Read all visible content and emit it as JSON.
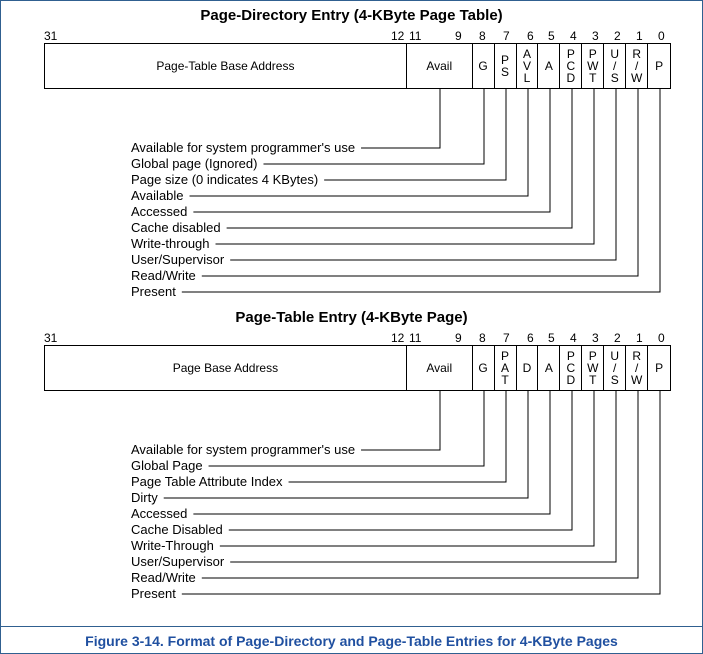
{
  "pde": {
    "title": "Page-Directory Entry (4-KByte Page Table)",
    "bit_left": "31",
    "bit_base_lo": "12",
    "bit_avail_hi": "11",
    "bits": [
      "9",
      "8",
      "7",
      "6",
      "5",
      "4",
      "3",
      "2",
      "1",
      "0"
    ],
    "base": "Page-Table Base Address",
    "avail": "Avail",
    "fields": [
      "G",
      "P\nS",
      "A\nV\nL",
      "A",
      "P\nC\nD",
      "P\nW\nT",
      "U\n/\nS",
      "R\n/\nW",
      "P"
    ],
    "descs": [
      "Available for system programmer's use",
      "Global page (Ignored)",
      "Page size (0 indicates 4 KBytes)",
      "Available",
      "Accessed",
      "Cache disabled",
      "Write-through",
      "User/Supervisor",
      "Read/Write",
      "Present"
    ]
  },
  "pte": {
    "title": "Page-Table Entry (4-KByte Page)",
    "bit_left": "31",
    "bit_base_lo": "12",
    "bit_avail_hi": "11",
    "bits": [
      "9",
      "8",
      "7",
      "6",
      "5",
      "4",
      "3",
      "2",
      "1",
      "0"
    ],
    "base": "Page Base Address",
    "avail": "Avail",
    "fields": [
      "G",
      "P\nA\nT",
      "D",
      "A",
      "P\nC\nD",
      "P\nW\nT",
      "U\n/\nS",
      "R\n/\nW",
      "P"
    ],
    "descs": [
      "Available for system programmer's use",
      "Global Page",
      "Page Table Attribute Index",
      "Dirty",
      "Accessed",
      "Cache Disabled",
      "Write-Through",
      "User/Supervisor",
      "Read/Write",
      "Present"
    ]
  },
  "caption": "Figure 3-14.  Format of Page-Directory and Page-Table Entries for 4-KByte Pages"
}
